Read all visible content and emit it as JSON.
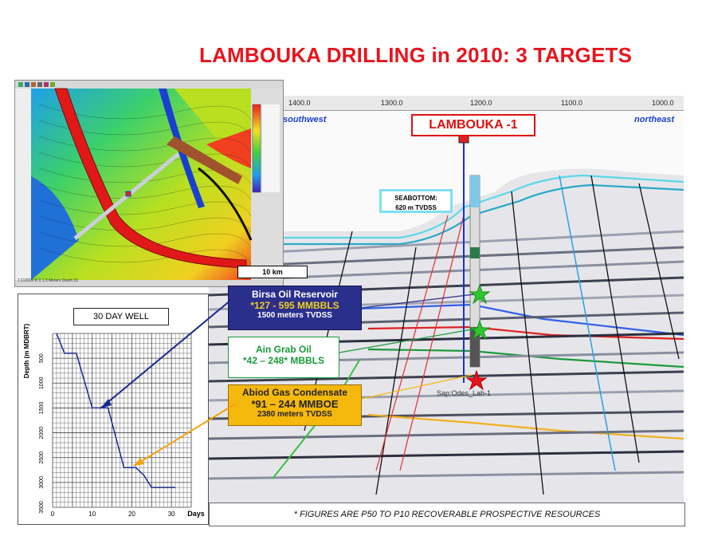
{
  "title": "LAMBOUKA DRILLING in 2010:  3 TARGETS",
  "seismic": {
    "ruler_ticks": [
      "1400.0",
      "1300.0",
      "1200.0",
      "1100.0",
      "1000.0"
    ],
    "dir_left": "southwest",
    "dir_right": "northeast",
    "well_label": "LAMBOUKA -1",
    "seabottom_line1": "SEABOTTOM:",
    "seabottom_line2": "620 m TVDSS",
    "well_tag": "Sap:Odes_Lah-1"
  },
  "map": {
    "scale_label": "10 km",
    "status_text": "1:113000  K:1  1.0 Meters  Depth:33"
  },
  "callouts": {
    "birsa": {
      "line1": "Birsa Oil Reservoir",
      "line2": "*127 -  595 MMBBLS",
      "line3": "1500 meters TVDSS"
    },
    "aingrab": {
      "line1": "Ain Grab Oil",
      "line2": "*42 – 248* MBBLS"
    },
    "abiod": {
      "line1": "Abiod Gas Condensate",
      "line2": "*91 – 244 MMBOE",
      "line3": "2380 meters TVDSS"
    }
  },
  "footnote": "* FIGURES ARE P50 TO P10  RECOVERABLE PROSPECTIVE RESOURCES",
  "colors": {
    "birsa_star": "#2ec82e",
    "aingrab_star": "#2ec82e",
    "abiod_star": "#e8141c",
    "title": "#e8141c"
  },
  "chart_data": {
    "type": "line",
    "title": "30 DAY WELL",
    "xlabel": "Days",
    "ylabel": "Depth (m MDBRT)",
    "xlim": [
      0,
      35
    ],
    "ylim": [
      3500,
      0
    ],
    "x_ticks": [
      "0",
      "10",
      "20",
      "30"
    ],
    "y_ticks": [
      "500",
      "1000",
      "1500",
      "2000",
      "2500",
      "3000",
      "3500"
    ],
    "series": [
      {
        "x": [
          1,
          3,
          6,
          10,
          14,
          18,
          21,
          23,
          25,
          31
        ],
        "y": [
          0,
          400,
          400,
          1500,
          1500,
          2700,
          2700,
          2850,
          3100,
          3100
        ]
      }
    ]
  }
}
